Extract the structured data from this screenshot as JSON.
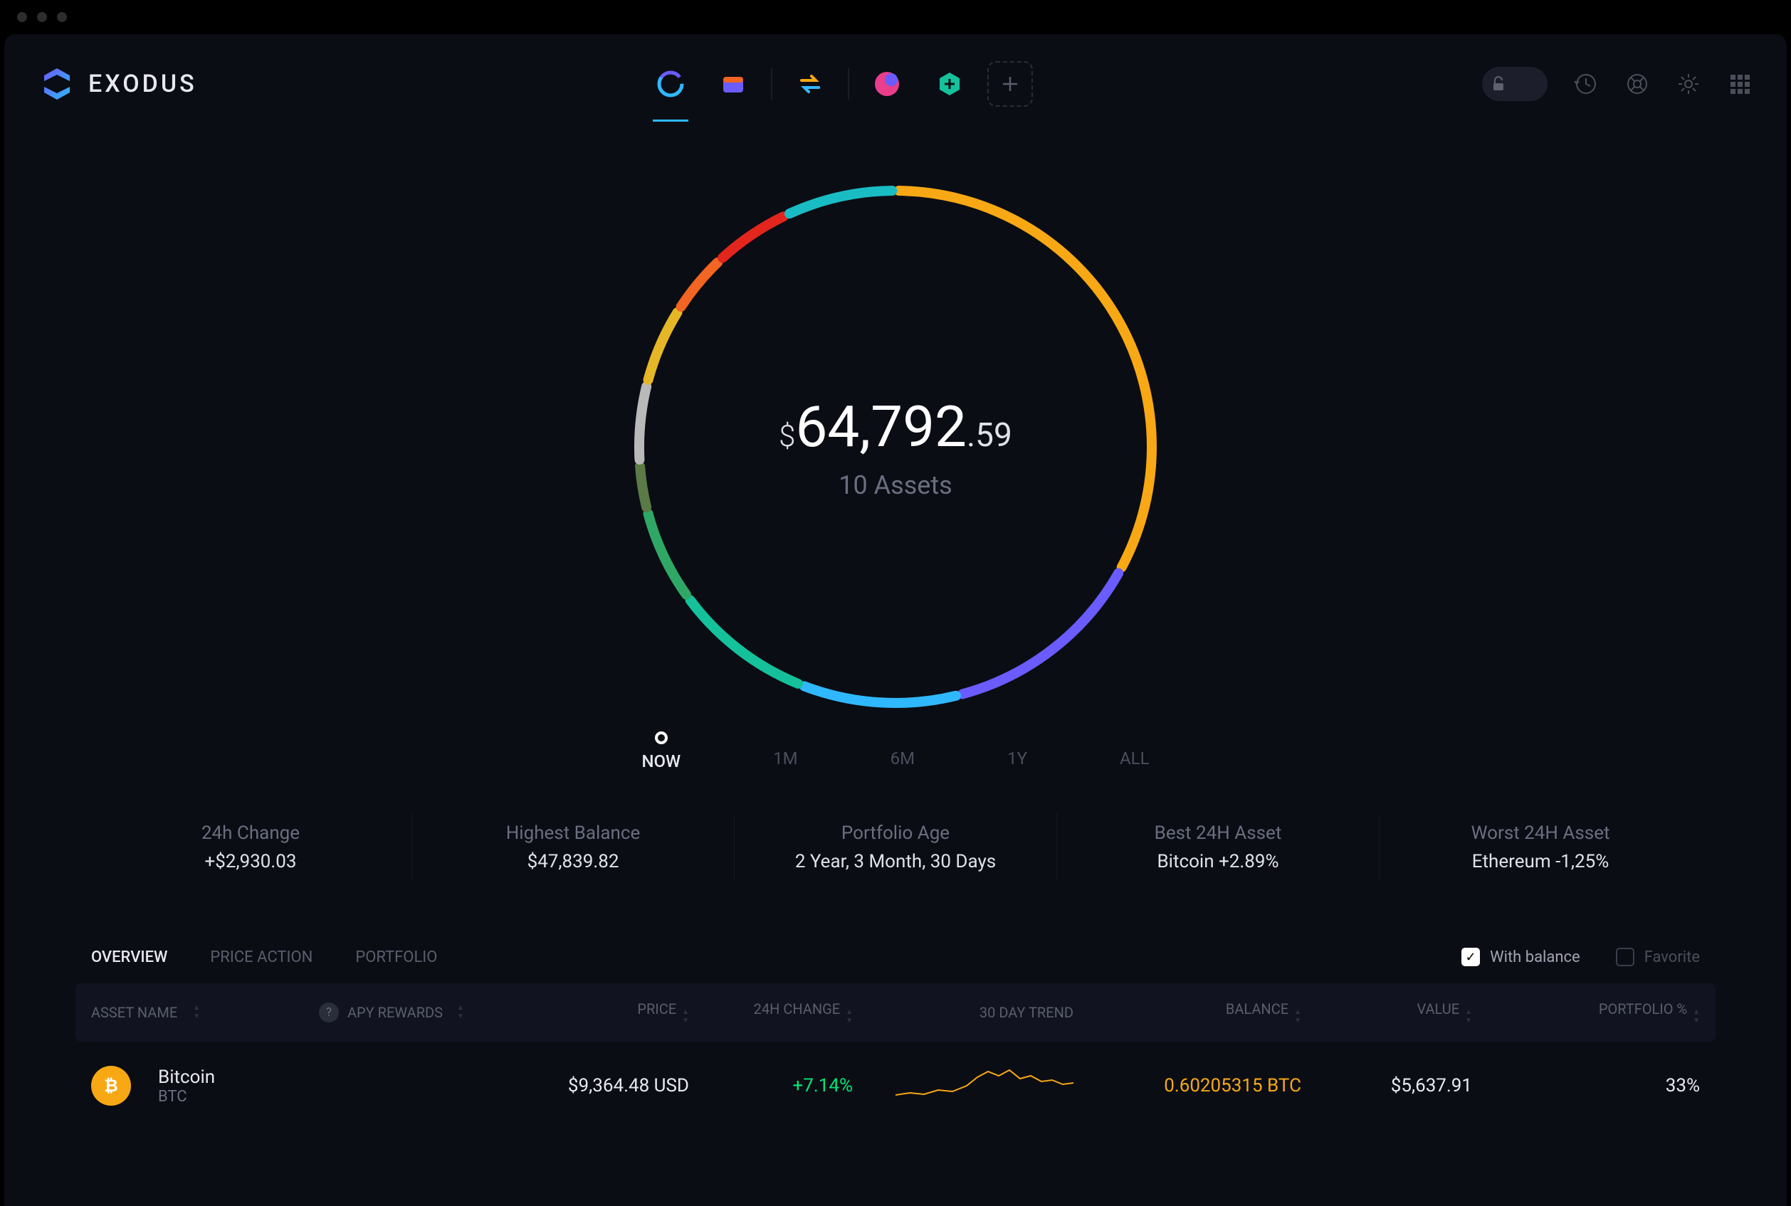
{
  "app_name": "EXODUS",
  "balance": {
    "currency_symbol": "$",
    "main": "64,792",
    "cents": ".59",
    "assets_count": "10 Assets"
  },
  "timeframes": [
    {
      "label": "NOW",
      "active": true
    },
    {
      "label": "1M",
      "active": false
    },
    {
      "label": "6M",
      "active": false
    },
    {
      "label": "1Y",
      "active": false
    },
    {
      "label": "ALL",
      "active": false
    }
  ],
  "stats": [
    {
      "label": "24h Change",
      "value": "+$2,930.03"
    },
    {
      "label": "Highest Balance",
      "value": "$47,839.82"
    },
    {
      "label": "Portfolio Age",
      "value": "2 Year, 3 Month, 30 Days"
    },
    {
      "label": "Best 24H Asset",
      "value": "Bitcoin +2.89%"
    },
    {
      "label": "Worst 24H Asset",
      "value": "Ethereum -1,25%"
    }
  ],
  "tabs": [
    {
      "label": "OVERVIEW",
      "active": true
    },
    {
      "label": "PRICE ACTION",
      "active": false
    },
    {
      "label": "PORTFOLIO",
      "active": false
    }
  ],
  "filters": {
    "with_balance": {
      "label": "With balance",
      "checked": true
    },
    "favorite": {
      "label": "Favorite",
      "checked": false
    }
  },
  "columns": {
    "asset": "ASSET NAME",
    "apy": "APY REWARDS",
    "price": "PRICE",
    "change": "24H CHANGE",
    "trend": "30 DAY TREND",
    "balance": "BALANCE",
    "value": "VALUE",
    "pct": "PORTFOLIO %"
  },
  "rows": [
    {
      "name": "Bitcoin",
      "symbol": "BTC",
      "icon_color": "#f7a814",
      "price": "$9,364.48 USD",
      "change": "+7.14%",
      "balance": "0.60205315 BTC",
      "value": "$5,637.91",
      "pct": "33%"
    }
  ],
  "chart_data": {
    "type": "pie",
    "title": "Portfolio allocation",
    "total_value_usd": 64792.59,
    "slices": [
      {
        "color": "#f7a814",
        "percent": 33
      },
      {
        "color": "#6a5cff",
        "percent": 13
      },
      {
        "color": "#2fb8ff",
        "percent": 10
      },
      {
        "color": "#15c19b",
        "percent": 9
      },
      {
        "color": "#2fa866",
        "percent": 6
      },
      {
        "color": "#5a7a46",
        "percent": 3
      },
      {
        "color": "#b9b9b9",
        "percent": 5
      },
      {
        "color": "#e5b727",
        "percent": 5
      },
      {
        "color": "#f26522",
        "percent": 4
      },
      {
        "color": "#e2261e",
        "percent": 5
      },
      {
        "color": "#1abcc4",
        "percent": 7
      }
    ]
  }
}
